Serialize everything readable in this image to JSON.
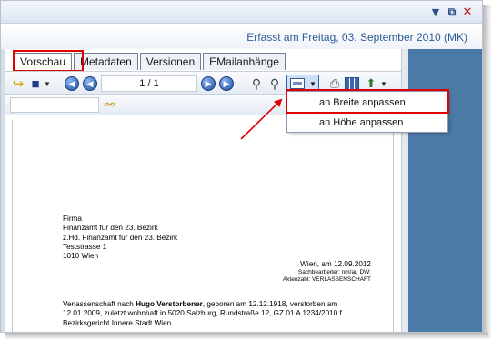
{
  "window": {
    "minimize_glyph": "▼",
    "restore_glyph": "⧉",
    "close_glyph": "✕"
  },
  "header": {
    "text": "Erfasst am Freitag, 03. September 2010 (MK)"
  },
  "tabs": [
    {
      "label": "Vorschau",
      "active": true
    },
    {
      "label": "Metadaten",
      "active": false
    },
    {
      "label": "Versionen",
      "active": false
    },
    {
      "label": "EMailanhänge",
      "active": false
    }
  ],
  "toolbar": {
    "page_indicator": "1 / 1",
    "icons": {
      "open": "↪",
      "save": "■",
      "dropdown": "▼",
      "first": "◀",
      "prev": "◀",
      "next": "▶",
      "last": "▶",
      "zoom_in": "⚲",
      "zoom_out": "⚲",
      "print": "⎙",
      "export": "⬆"
    }
  },
  "search": {
    "value": "",
    "binoculars_icon": "⚯"
  },
  "fit_menu": {
    "items": [
      "an Breite anpassen",
      "an Höhe anpassen"
    ],
    "highlighted": "an Breite anpassen"
  },
  "document": {
    "address": [
      "Firma",
      "Finanzamt für den 23. Bezirk",
      "z.Hd. Finanzamt für den 23. Bezirk",
      "Teststrasse 1",
      "1010 Wien"
    ],
    "date_line": "Wien, am 12.09.2012",
    "meta_line_1": "Sachbearbeiter: nm/ar, DW:",
    "meta_line_2": "Aktenzahl: VERLASSENSCHAFT",
    "body_prefix": "Verlassenschaft nach ",
    "body_name": "Hugo Verstorbener",
    "body_suffix": ", geboren am 12.12.1918, verstorben am 12.01.2009, zuletzt wohnhaft in 5020 Salzburg, Rundstraße 12, GZ 01 A 1234/2010 f Bezirksgericht Innere Stadt Wien"
  },
  "colors": {
    "highlight_red": "#e00000",
    "side_band": "#4b7aa6",
    "header_text": "#2d5b95"
  }
}
